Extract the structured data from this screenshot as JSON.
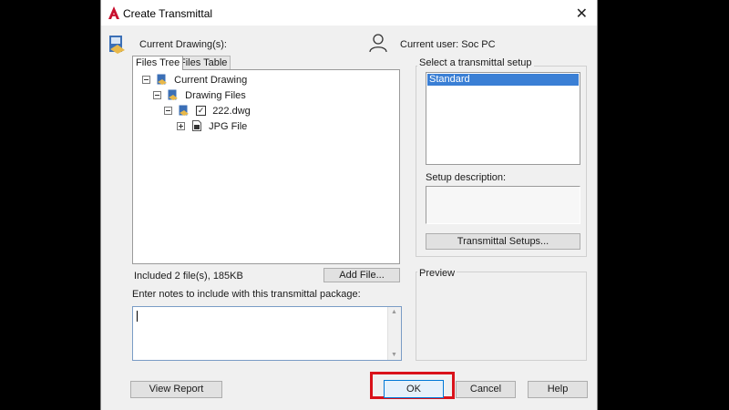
{
  "window": {
    "title": "Create Transmittal"
  },
  "header": {
    "current_drawings_label": "Current Drawing(s):",
    "current_user_label": "Current user: Soc PC"
  },
  "tabs": [
    {
      "label": "Files Tree"
    },
    {
      "label": "Files Table"
    }
  ],
  "tree": {
    "current_drawing": "Current Drawing",
    "drawing_files": "Drawing Files",
    "dwg_file": "222.dwg",
    "jpg_file": "JPG File"
  },
  "included_text": "Included 2 file(s), 185KB",
  "add_file_label": "Add File...",
  "notes": {
    "label": "Enter notes to include with this transmittal package:",
    "value": ""
  },
  "setup": {
    "label": "Select a transmittal setup",
    "items": [
      "Standard"
    ],
    "description_label": "Setup description:",
    "setups_button": "Transmittal Setups..."
  },
  "preview_label": "Preview",
  "buttons": {
    "view_report": "View Report",
    "ok": "OK",
    "cancel": "Cancel",
    "help": "Help"
  },
  "colors": {
    "selection": "#3a7fd5",
    "highlight_box": "#d9121a",
    "brand": "#c8102e"
  }
}
